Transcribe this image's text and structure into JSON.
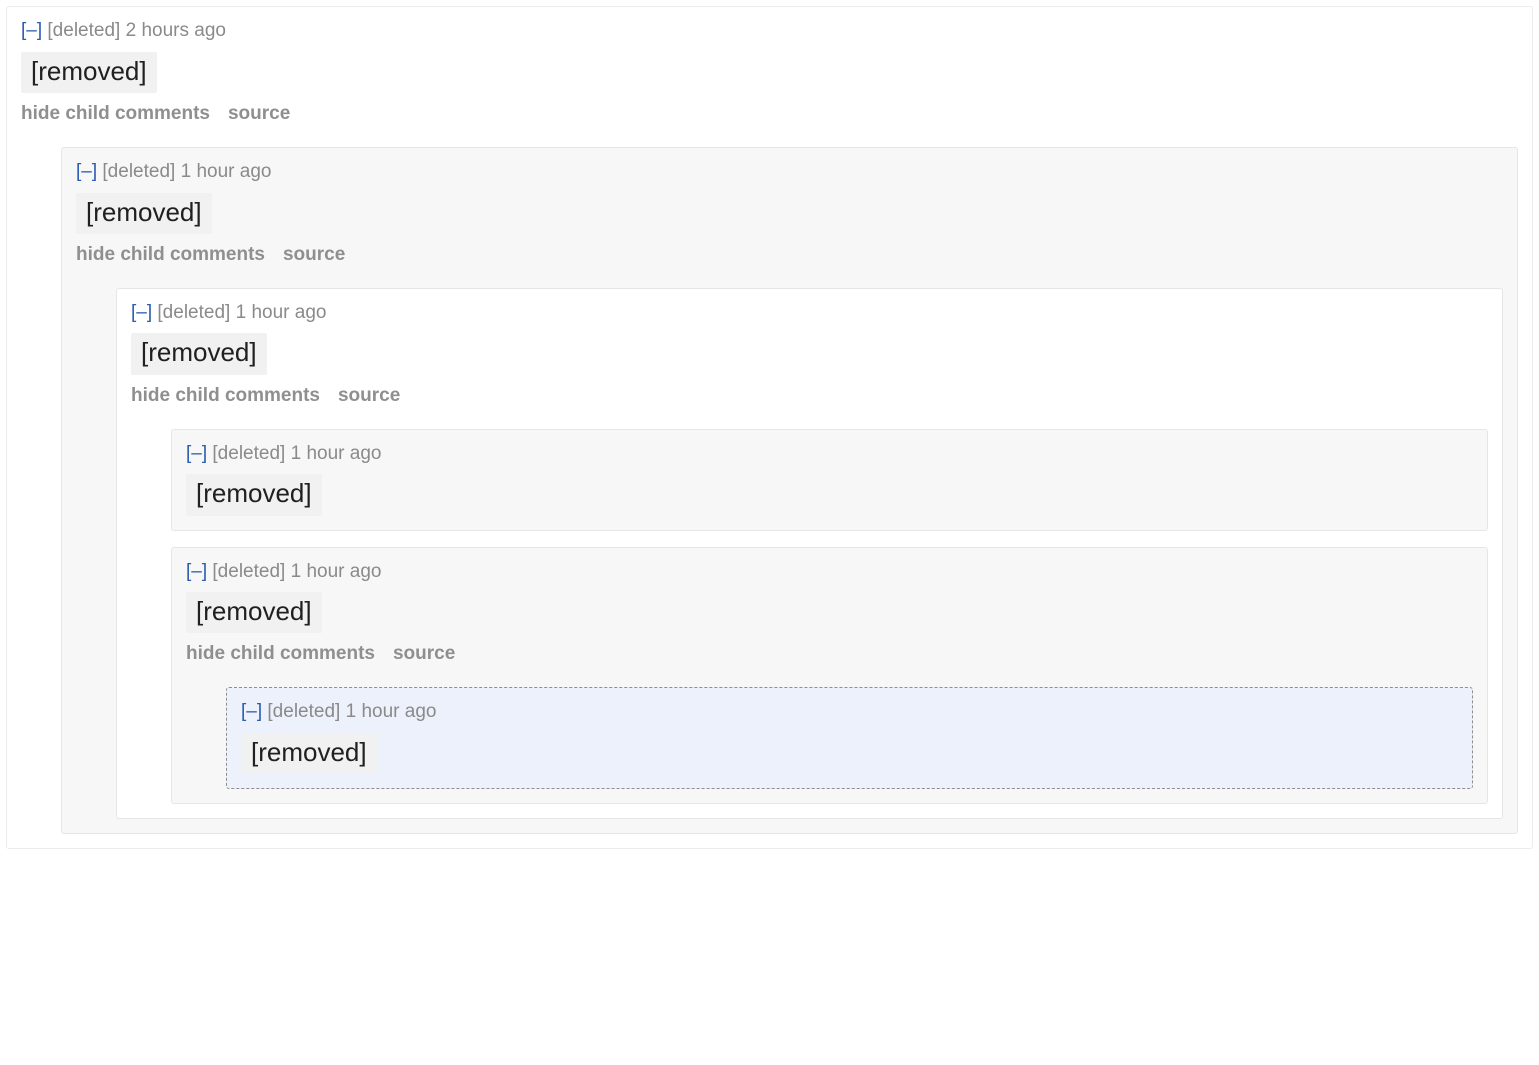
{
  "labels": {
    "collapse": "[–]",
    "hide_children": "hide child comments",
    "source": "source"
  },
  "comments": {
    "author": "[deleted]",
    "time": "2 hours ago",
    "body": "[removed]",
    "highlight": false,
    "has_actions": true,
    "children": [
      {
        "author": "[deleted]",
        "time": "1 hour ago",
        "body": "[removed]",
        "highlight": false,
        "has_actions": true,
        "children": [
          {
            "author": "[deleted]",
            "time": "1 hour ago",
            "body": "[removed]",
            "highlight": false,
            "has_actions": true,
            "children": [
              {
                "author": "[deleted]",
                "time": "1 hour ago",
                "body": "[removed]",
                "highlight": false,
                "has_actions": false,
                "children": []
              },
              {
                "author": "[deleted]",
                "time": "1 hour ago",
                "body": "[removed]",
                "highlight": false,
                "has_actions": true,
                "children": [
                  {
                    "author": "[deleted]",
                    "time": "1 hour ago",
                    "body": "[removed]",
                    "highlight": true,
                    "has_actions": false,
                    "children": []
                  }
                ]
              }
            ]
          }
        ]
      }
    ]
  }
}
